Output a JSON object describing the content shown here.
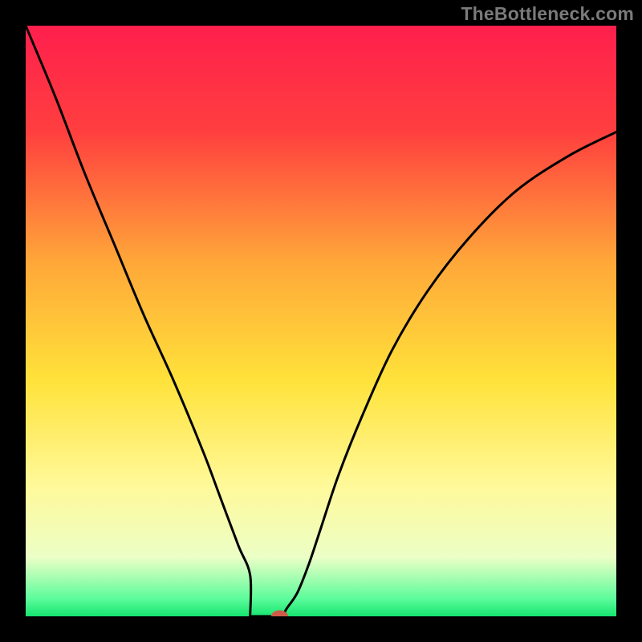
{
  "watermark": "TheBottleneck.com",
  "chart_data": {
    "type": "line",
    "title": "",
    "xlabel": "",
    "ylabel": "",
    "xlim": [
      0,
      100
    ],
    "ylim": [
      0,
      100
    ],
    "background_gradient": {
      "stops": [
        {
          "offset": 0,
          "color": "#ff1f4d"
        },
        {
          "offset": 18,
          "color": "#ff3f3f"
        },
        {
          "offset": 40,
          "color": "#ffa739"
        },
        {
          "offset": 60,
          "color": "#ffe23a"
        },
        {
          "offset": 78,
          "color": "#fff99a"
        },
        {
          "offset": 90,
          "color": "#ecffc6"
        },
        {
          "offset": 97,
          "color": "#5dfc9c"
        },
        {
          "offset": 100,
          "color": "#16e56f"
        }
      ]
    },
    "series": [
      {
        "name": "bottleneck-curve",
        "x": [
          0,
          5,
          10,
          15,
          20,
          25,
          30,
          33,
          36,
          38,
          40,
          41,
          42,
          43,
          44,
          46,
          48,
          50,
          53,
          57,
          62,
          68,
          75,
          83,
          92,
          100
        ],
        "y": [
          100,
          88,
          75,
          63,
          51,
          40,
          28,
          20,
          12,
          7,
          3,
          1,
          0,
          0,
          1,
          4,
          9,
          15,
          24,
          34,
          45,
          55,
          64,
          72,
          78,
          82
        ]
      }
    ],
    "flat_segment": {
      "x_start": 38,
      "x_end": 44,
      "y": 0
    },
    "marker": {
      "x": 43,
      "y": 0,
      "color": "#cf5a48"
    },
    "axes_visible": false,
    "grid": false
  }
}
